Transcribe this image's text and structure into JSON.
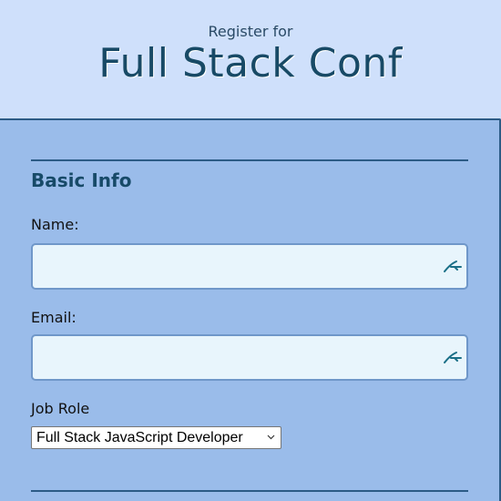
{
  "header": {
    "pre_title": "Register for",
    "title": "Full Stack Conf"
  },
  "form": {
    "section_title": "Basic Info",
    "name": {
      "label": "Name:",
      "value": "",
      "placeholder": ""
    },
    "email": {
      "label": "Email:",
      "value": "",
      "placeholder": ""
    },
    "job_role": {
      "label": "Job Role",
      "selected": "Full Stack JavaScript Developer"
    },
    "field_icon": "autofill-key-icon",
    "colors": {
      "header_bg": "#cfe0fb",
      "panel_bg": "#9abcea",
      "accent": "#2c5b86",
      "title": "#184a66",
      "input_bg": "#e8f5fc"
    }
  }
}
